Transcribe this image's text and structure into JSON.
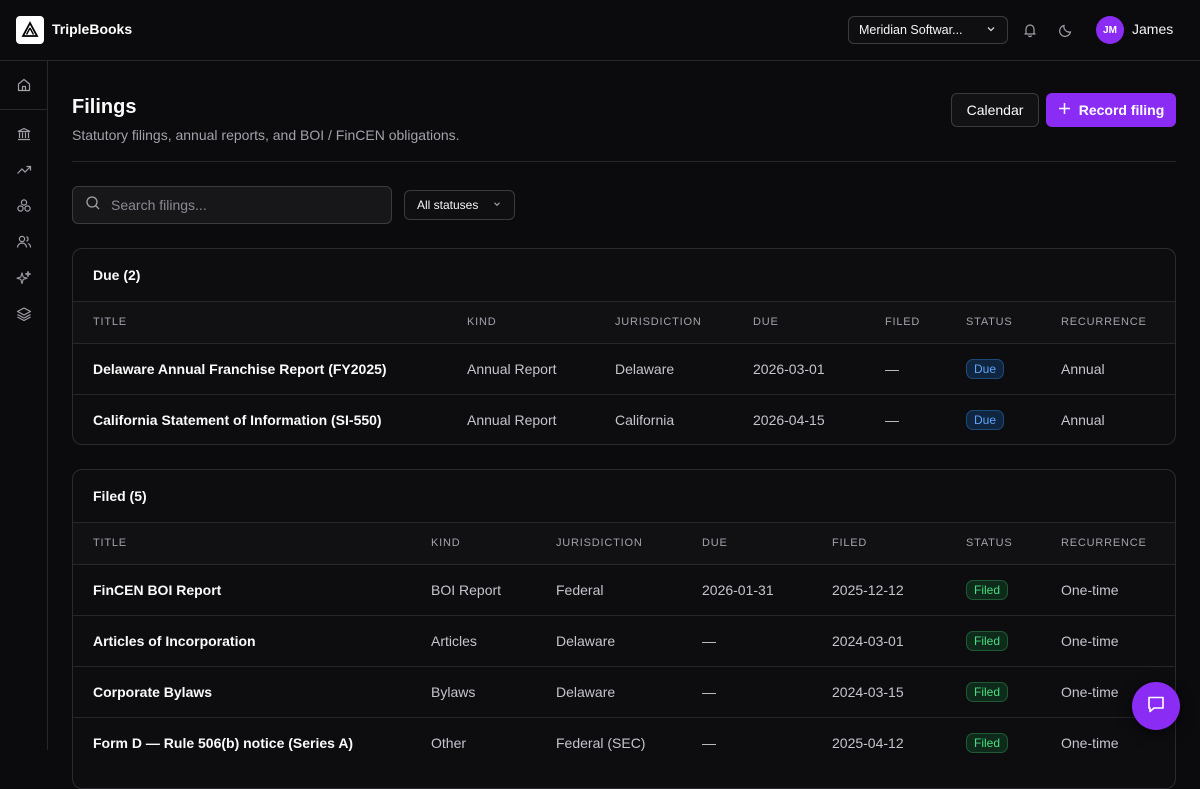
{
  "app": {
    "name": "TripleBooks"
  },
  "header": {
    "org": "Meridian Softwar...",
    "user_initials": "JM",
    "user_name": "James"
  },
  "sidebar": {
    "items": [
      {
        "icon": "home-icon"
      },
      {
        "icon": "bank-icon"
      },
      {
        "icon": "trending-up-icon"
      },
      {
        "icon": "entities-icon"
      },
      {
        "icon": "users-icon"
      },
      {
        "icon": "sparkles-icon"
      },
      {
        "icon": "layers-icon"
      }
    ]
  },
  "page": {
    "title": "Filings",
    "subtitle": "Statutory filings, annual reports, and BOI / FinCEN obligations.",
    "calendar_label": "Calendar",
    "record_label": "Record filing",
    "search_placeholder": "Search filings...",
    "status_filter": "All statuses"
  },
  "columns": [
    "TITLE",
    "KIND",
    "JURISDICTION",
    "DUE",
    "FILED",
    "STATUS",
    "RECURRENCE"
  ],
  "due_section": {
    "title": "Due (2)",
    "rows": [
      [
        "Delaware Annual Franchise Report (FY2025)",
        "Annual Report",
        "Delaware",
        "2026-03-01",
        "—",
        "Due",
        "Annual"
      ],
      [
        "California Statement of Information (SI-550)",
        "Annual Report",
        "California",
        "2026-04-15",
        "—",
        "Due",
        "Annual"
      ]
    ]
  },
  "filed_section": {
    "title": "Filed (5)",
    "rows": [
      [
        "FinCEN BOI Report",
        "BOI Report",
        "Federal",
        "2026-01-31",
        "2025-12-12",
        "Filed",
        "One-time"
      ],
      [
        "Articles of Incorporation",
        "Articles",
        "Delaware",
        "—",
        "2024-03-01",
        "Filed",
        "One-time"
      ],
      [
        "Corporate Bylaws",
        "Bylaws",
        "Delaware",
        "—",
        "2024-03-15",
        "Filed",
        "One-time"
      ],
      [
        "Form D — Rule 506(b) notice (Series A)",
        "Other",
        "Federal (SEC)",
        "—",
        "2025-04-12",
        "Filed",
        "One-time"
      ]
    ]
  },
  "colors": {
    "accent": "#8b2cf5",
    "due": "#60a5fa",
    "filed": "#4ade80"
  }
}
